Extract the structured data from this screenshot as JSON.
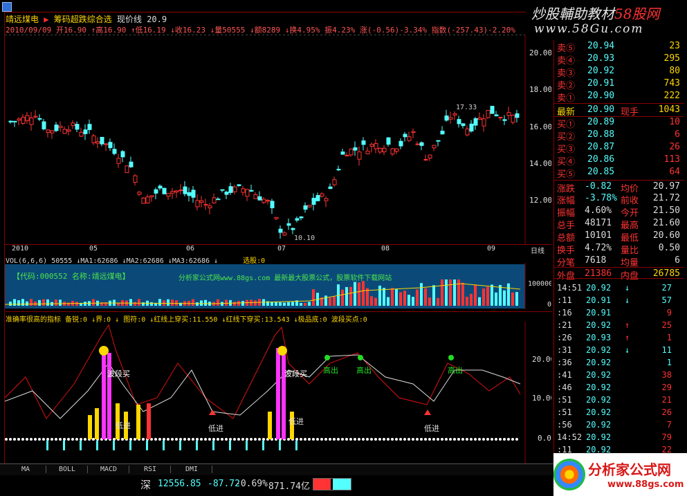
{
  "app": {
    "window_title": "靖远煤电",
    "window_title_2": "炒股辅助教材58股网"
  },
  "header": {
    "stock_name": "靖远煤电",
    "indicator_label": "筹码超跌综合选",
    "current_price_label": "现价线",
    "current_price": "20.9",
    "info_line": "2010/09/09 开16.90 ↑高16.90 ↑低16.19 ↓收16.23 ↓量50555 ↓额8289 ↓换4.95% 振4.23% 涨(-0.56)-3.34% 指数(-257.43)-2.20%"
  },
  "price_axis": {
    "ticks": [
      "20.00",
      "18.00",
      "16.00",
      "14.00",
      "12.00"
    ],
    "annotations": [
      "17.33",
      "10.10"
    ]
  },
  "date_axis": {
    "labels": [
      "2010",
      "05",
      "06",
      "07",
      "08",
      "09"
    ],
    "period": "日线"
  },
  "volume": {
    "label_line": "VOL(6,6,6) 50555 ↓MA1:62686 ↓MA2:62686 ↓MA3:62686 ↓",
    "select_label": "选股:0",
    "ad_code": "【代码:000552 名称:靖远煤电】",
    "ad_site": "分析家公式网www.88gs.com 最新最大股票公式，股票软件下载网站",
    "axis": [
      "100000",
      "0"
    ]
  },
  "indicator": {
    "label_line": "准确率很高的指标 备锐:0 ↓界:0 ↓ 图符:0 ↓红线上穿买:11.550 ↓红线下穿买:13.543 ↓极品底:0  波段买点:0",
    "axis": [
      "20.00",
      "10.00",
      "0.00"
    ],
    "annotations": [
      "波段买",
      "波段买",
      "高出",
      "高出",
      "高出",
      "低进",
      "低进",
      "低进",
      "低进"
    ]
  },
  "brand": {
    "line1": "炒股輔助教材",
    "line1_red": "58股网",
    "line2": "www.58Gu.com"
  },
  "order_book": {
    "asks": [
      {
        "label": "卖⑤",
        "price": "20.94",
        "vol": "23"
      },
      {
        "label": "卖④",
        "price": "20.93",
        "vol": "295"
      },
      {
        "label": "卖③",
        "price": "20.92",
        "vol": "80"
      },
      {
        "label": "卖②",
        "price": "20.91",
        "vol": "743"
      },
      {
        "label": "卖①",
        "price": "20.90",
        "vol": "222"
      }
    ],
    "latest": {
      "label": "最新",
      "price": "20.90",
      "label2": "现手",
      "vol": "1043"
    },
    "bids": [
      {
        "label": "买①",
        "price": "20.89",
        "vol": "10"
      },
      {
        "label": "买②",
        "price": "20.88",
        "vol": "6"
      },
      {
        "label": "买③",
        "price": "20.87",
        "vol": "26"
      },
      {
        "label": "买④",
        "price": "20.86",
        "vol": "113"
      },
      {
        "label": "买⑤",
        "price": "20.85",
        "vol": "64"
      }
    ]
  },
  "stats": [
    {
      "l1": "涨跌",
      "v1": "-0.82",
      "l2": "均价",
      "v2": "20.97"
    },
    {
      "l1": "涨幅",
      "v1": "-3.78%",
      "l2": "前收",
      "v2": "21.72"
    },
    {
      "l1": "振幅",
      "v1": "4.60%",
      "l2": "今开",
      "v2": "21.50"
    },
    {
      "l1": "总手",
      "v1": "48171",
      "l2": "最高",
      "v2": "21.60"
    },
    {
      "l1": "总额",
      "v1": "10101",
      "l2": "最低",
      "v2": "20.60"
    },
    {
      "l1": "换手",
      "v1": "4.72%",
      "l2": "量比",
      "v2": "0.50"
    },
    {
      "l1": "分笔",
      "v1": "7618",
      "l2": "均量",
      "v2": "6"
    },
    {
      "l1": "外盘",
      "v1": "21386",
      "l2": "内盘",
      "v2": "26785"
    }
  ],
  "trades": [
    {
      "t": "14:51",
      "p": "20.92",
      "d": "↓",
      "v": "27"
    },
    {
      "t": ":11",
      "p": "20.91",
      "d": "↓",
      "v": "57"
    },
    {
      "t": ":16",
      "p": "20.91",
      "d": "",
      "v": "9"
    },
    {
      "t": ":21",
      "p": "20.92",
      "d": "↑",
      "v": "25"
    },
    {
      "t": ":26",
      "p": "20.93",
      "d": "↑",
      "v": "1"
    },
    {
      "t": ":31",
      "p": "20.92",
      "d": "↓",
      "v": "11"
    },
    {
      "t": ":36",
      "p": "20.92",
      "d": "",
      "v": "1"
    },
    {
      "t": ":41",
      "p": "20.92",
      "d": "",
      "v": "38"
    },
    {
      "t": ":46",
      "p": "20.92",
      "d": "",
      "v": "29"
    },
    {
      "t": ":51",
      "p": "20.92",
      "d": "",
      "v": "21"
    },
    {
      "t": ":51",
      "p": "20.92",
      "d": "",
      "v": "26"
    },
    {
      "t": ":56",
      "p": "20.92",
      "d": "",
      "v": "7"
    },
    {
      "t": "14:52",
      "p": "20.92",
      "d": "",
      "v": "79"
    },
    {
      "t": ":11",
      "p": "20.92",
      "d": "",
      "v": "22"
    }
  ],
  "tabs": [
    "MA",
    "BOLL",
    "MACD",
    "RSI",
    "DMI"
  ],
  "status": {
    "market": "深",
    "index": "12556.85",
    "change": "-87.72",
    "pct": "-0.69%",
    "amount": "871.74亿"
  },
  "logo": {
    "text": "分析家公式网",
    "url": "www.88gs.com"
  },
  "colors": {
    "up": "#ff3333",
    "down": "#54ffff",
    "price_line": "#ffd700",
    "accent_green": "#22dd22"
  }
}
